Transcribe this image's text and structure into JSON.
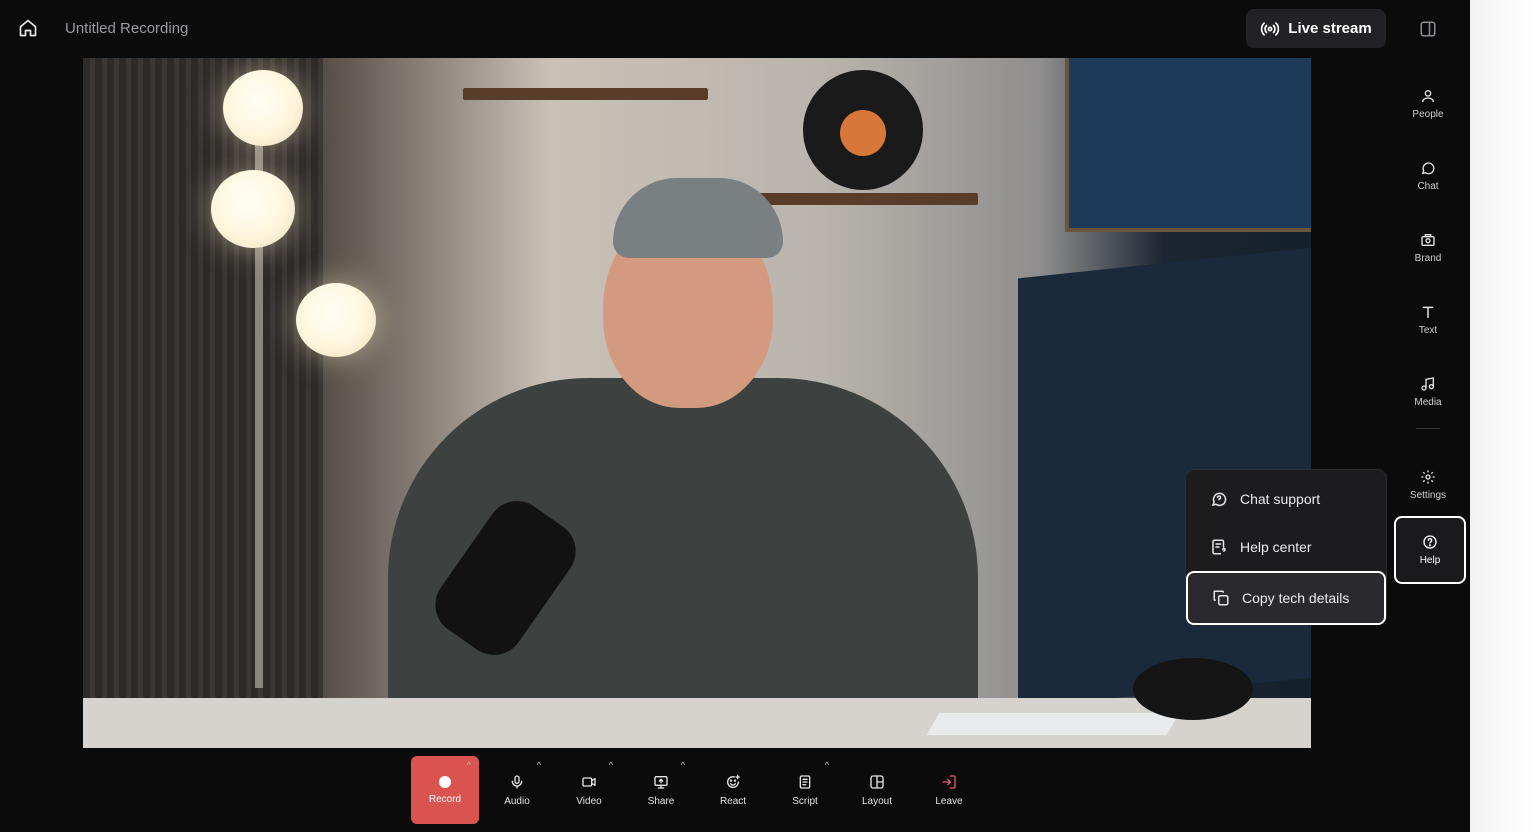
{
  "header": {
    "title": "Untitled Recording",
    "live_stream_label": "Live stream"
  },
  "rail": {
    "items": [
      {
        "label": "People",
        "icon": "people-icon"
      },
      {
        "label": "Chat",
        "icon": "chat-icon"
      },
      {
        "label": "Brand",
        "icon": "brand-icon"
      },
      {
        "label": "Text",
        "icon": "text-icon"
      },
      {
        "label": "Media",
        "icon": "music-note-icon"
      },
      {
        "label": "Settings",
        "icon": "gear-icon"
      },
      {
        "label": "Help",
        "icon": "help-icon"
      }
    ]
  },
  "help_menu": {
    "items": [
      {
        "label": "Chat support",
        "icon": "chat-support-icon"
      },
      {
        "label": "Help center",
        "icon": "help-center-icon"
      },
      {
        "label": "Copy tech details",
        "icon": "copy-icon"
      }
    ]
  },
  "toolbar": {
    "items": [
      {
        "label": "Record"
      },
      {
        "label": "Audio"
      },
      {
        "label": "Video"
      },
      {
        "label": "Share"
      },
      {
        "label": "React"
      },
      {
        "label": "Script"
      },
      {
        "label": "Layout"
      },
      {
        "label": "Leave"
      }
    ]
  },
  "colors": {
    "background": "#0b0b0c",
    "record": "#d9534f",
    "leave": "#e0606a"
  }
}
